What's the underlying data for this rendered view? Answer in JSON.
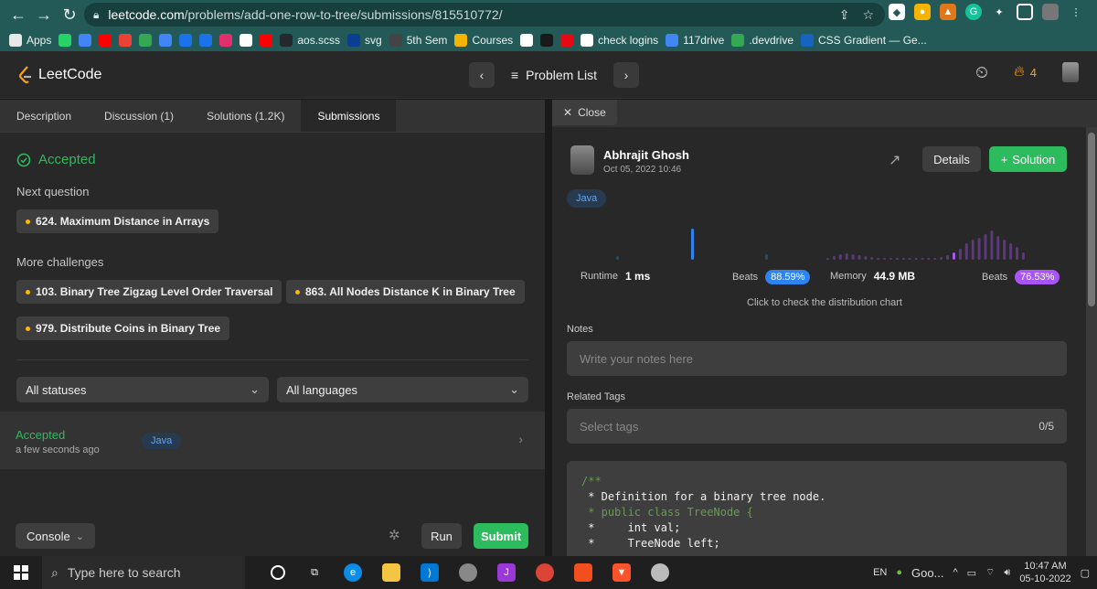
{
  "browser": {
    "url_domain": "leetcode.com",
    "url_path": "/problems/add-one-row-to-tree/submissions/815510772/",
    "bookmarks": [
      {
        "label": "Apps",
        "color": "#e8e8e8"
      },
      {
        "label": "",
        "color": "#25d366"
      },
      {
        "label": "",
        "color": "#4285f4"
      },
      {
        "label": "",
        "color": "#ff0000"
      },
      {
        "label": "",
        "color": "#ea4335"
      },
      {
        "label": "",
        "color": "#34a853"
      },
      {
        "label": "",
        "color": "#4285f4"
      },
      {
        "label": "",
        "color": "#1a73e8"
      },
      {
        "label": "",
        "color": "#1a73e8"
      },
      {
        "label": "",
        "color": "#e1306c"
      },
      {
        "label": "",
        "color": "#ffffff"
      },
      {
        "label": "",
        "color": "#ff0000"
      },
      {
        "label": "aos.scss",
        "color": "#24292e"
      },
      {
        "label": "svg",
        "color": "#0b3d91"
      },
      {
        "label": "5th Sem",
        "color": "#444444"
      },
      {
        "label": "Courses",
        "color": "#f4b400"
      },
      {
        "label": "",
        "color": "#ffffff"
      },
      {
        "label": "",
        "color": "#1a1a1a"
      },
      {
        "label": "",
        "color": "#e50914"
      },
      {
        "label": "check logins",
        "color": "#ffffff"
      },
      {
        "label": "117drive",
        "color": "#4285f4"
      },
      {
        "label": ".devdrive",
        "color": "#34a853"
      },
      {
        "label": "CSS Gradient — Ge...",
        "color": "#1565c0"
      }
    ]
  },
  "navbar": {
    "logo": "LeetCode",
    "problem_list": "Problem List",
    "streak": "4"
  },
  "left": {
    "tabs": [
      "Description",
      "Discussion (1)",
      "Solutions (1.2K)",
      "Submissions"
    ],
    "status": "Accepted",
    "next_question_label": "Next question",
    "next_question": "624. Maximum Distance in Arrays",
    "more_challenges_label": "More challenges",
    "challenges": [
      "103. Binary Tree Zigzag Level Order Traversal",
      "863. All Nodes Distance K in Binary Tree",
      "979. Distribute Coins in Binary Tree"
    ],
    "status_filter": "All statuses",
    "language_filter": "All languages",
    "submission": {
      "status": "Accepted",
      "time": "a few seconds ago",
      "language": "Java"
    },
    "console": "Console",
    "run": "Run",
    "submit": "Submit"
  },
  "right": {
    "close": "Close",
    "user": "Abhrajit Ghosh",
    "date": "Oct 05, 2022 10:46",
    "details": "Details",
    "solution": "Solution",
    "language": "Java",
    "runtime_label": "Runtime",
    "runtime": "1 ms",
    "runtime_beats_label": "Beats",
    "runtime_beats": "88.59%",
    "memory_label": "Memory",
    "memory": "44.9 MB",
    "memory_beats_label": "Beats",
    "memory_beats": "76.53%",
    "chart_hint": "Click to check the distribution chart",
    "notes_label": "Notes",
    "notes_placeholder": "Write your notes here",
    "tags_label": "Related Tags",
    "tags_placeholder": "Select tags",
    "tags_count": "0/5",
    "code_lines": [
      "/**",
      " * Definition for a binary tree node.",
      " * public class TreeNode {",
      " *     int val;",
      " *     TreeNode left;"
    ]
  },
  "taskbar": {
    "search_placeholder": "Type here to search",
    "lang": "EN",
    "chrome_label": "Goo...",
    "time": "10:47 AM",
    "date": "05-10-2022"
  },
  "colors": {
    "accent_green": "#2cbb5d",
    "accent_orange": "#ffa116",
    "beats_blue": "#2d84f0",
    "beats_purple": "#a855f7"
  }
}
